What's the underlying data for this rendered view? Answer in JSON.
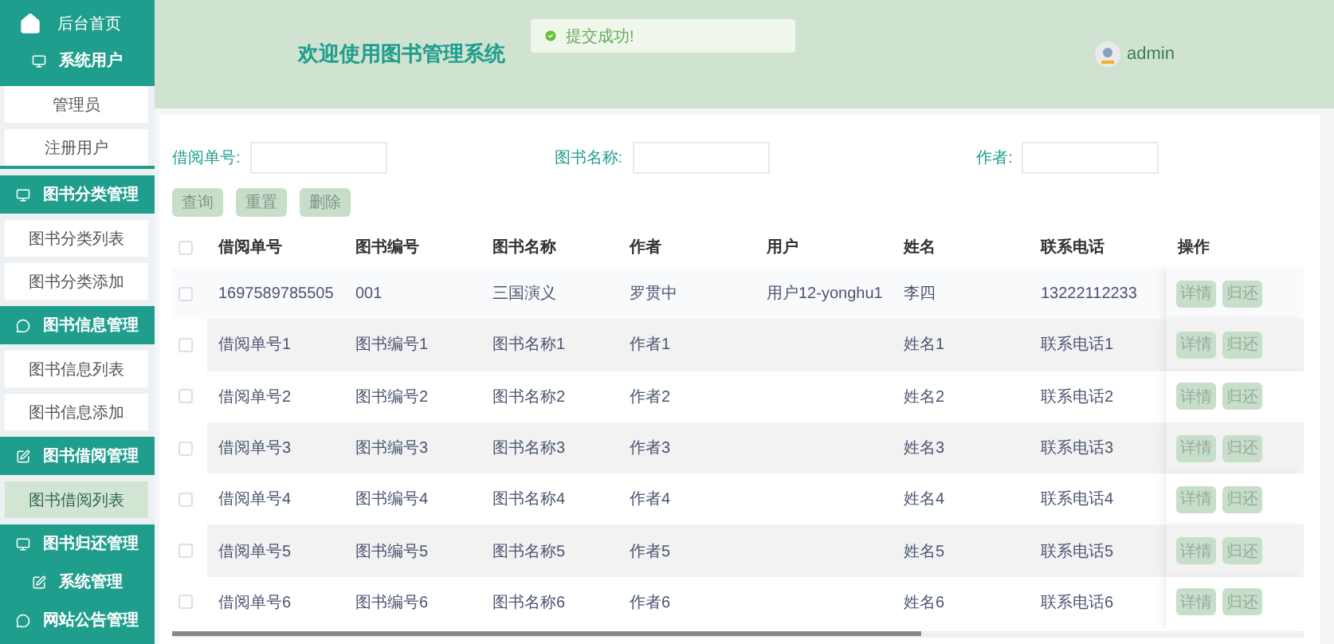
{
  "sidebar": {
    "home": {
      "label": "后台首页"
    },
    "groups": [
      {
        "label": "系统用户",
        "items": [
          {
            "label": "管理员",
            "selected": false
          },
          {
            "label": "注册用户",
            "selected": false
          }
        ]
      },
      {
        "label": "图书分类管理",
        "items": [
          {
            "label": "图书分类列表",
            "selected": false
          },
          {
            "label": "图书分类添加",
            "selected": false
          }
        ]
      },
      {
        "label": "图书信息管理",
        "items": [
          {
            "label": "图书信息列表",
            "selected": false
          },
          {
            "label": "图书信息添加",
            "selected": false
          }
        ]
      },
      {
        "label": "图书借阅管理",
        "items": [
          {
            "label": "图书借阅列表",
            "selected": true
          }
        ]
      },
      {
        "label": "图书归还管理"
      },
      {
        "label": "系统管理"
      },
      {
        "label": "网站公告管理"
      }
    ]
  },
  "header": {
    "title": "欢迎使用图书管理系统",
    "toast": {
      "message": "提交成功!"
    },
    "user": {
      "name": "admin"
    }
  },
  "filters": [
    {
      "label": "借阅单号:"
    },
    {
      "label": "图书名称:"
    },
    {
      "label": "作者:"
    }
  ],
  "buttons": [
    "查询",
    "重置",
    "删除"
  ],
  "table": {
    "header_checked": false,
    "columns": [
      "借阅单号",
      "图书编号",
      "图书名称",
      "作者",
      "用户",
      "姓名",
      "联系电话",
      "操作"
    ],
    "rows": [
      {
        "checked": false,
        "cells": [
          "1697589785505",
          "001",
          "三国演义",
          "罗贯中",
          "用户12-yonghu1",
          "李四",
          "13222112233"
        ],
        "actions": [
          "详情",
          "归还"
        ]
      },
      {
        "checked": false,
        "cells": [
          "借阅单号1",
          "图书编号1",
          "图书名称1",
          "作者1",
          "",
          "姓名1",
          "联系电话1"
        ],
        "actions": [
          "详情",
          "归还"
        ]
      },
      {
        "checked": false,
        "cells": [
          "借阅单号2",
          "图书编号2",
          "图书名称2",
          "作者2",
          "",
          "姓名2",
          "联系电话2"
        ],
        "actions": [
          "详情",
          "归还"
        ]
      },
      {
        "checked": false,
        "cells": [
          "借阅单号3",
          "图书编号3",
          "图书名称3",
          "作者3",
          "",
          "姓名3",
          "联系电话3"
        ],
        "actions": [
          "详情",
          "归还"
        ]
      },
      {
        "checked": false,
        "cells": [
          "借阅单号4",
          "图书编号4",
          "图书名称4",
          "作者4",
          "",
          "姓名4",
          "联系电话4"
        ],
        "actions": [
          "详情",
          "归还"
        ]
      },
      {
        "checked": false,
        "cells": [
          "借阅单号5",
          "图书编号5",
          "图书名称5",
          "作者5",
          "",
          "姓名5",
          "联系电话5"
        ],
        "actions": [
          "详情",
          "归还"
        ]
      },
      {
        "checked": false,
        "cells": [
          "借阅单号6",
          "图书编号6",
          "图书名称6",
          "作者6",
          "",
          "姓名6",
          "联系电话6"
        ],
        "actions": [
          "详情",
          "归还"
        ]
      }
    ]
  }
}
